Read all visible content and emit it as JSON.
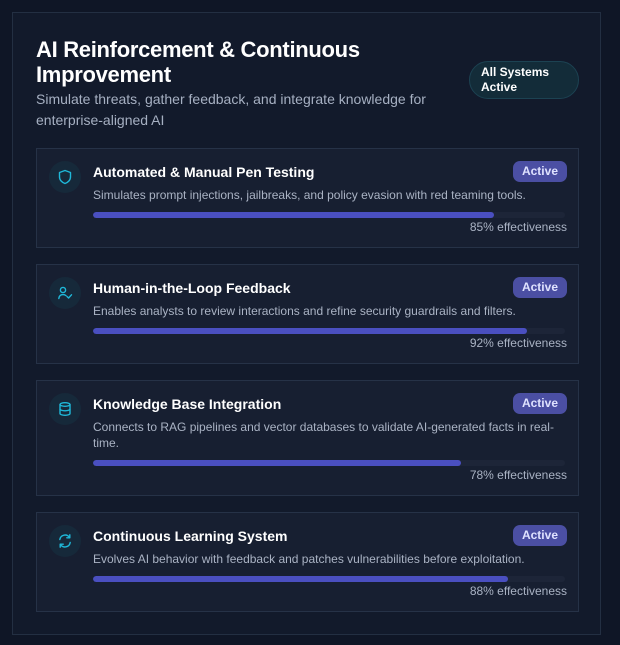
{
  "header": {
    "title": "AI Reinforcement & Continuous Improvement",
    "subtitle": "Simulate threats, gather feedback, and integrate knowledge for enterprise-aligned AI",
    "status_label": "All Systems Active"
  },
  "colors": {
    "accent": "#4a4fc0",
    "badge_bg": "#4b4fa3",
    "icon_color": "#1fb8d9"
  },
  "cards": [
    {
      "icon": "shield-icon",
      "title": "Automated & Manual Pen Testing",
      "badge": "Active",
      "description": "Simulates prompt injections, jailbreaks, and policy evasion with red teaming tools.",
      "effectiveness": 0.85,
      "effectiveness_label": "85% effectiveness"
    },
    {
      "icon": "user-check-icon",
      "title": "Human-in-the-Loop Feedback",
      "badge": "Active",
      "description": "Enables analysts to review interactions and refine security guardrails and filters.",
      "effectiveness": 0.92,
      "effectiveness_label": "92% effectiveness"
    },
    {
      "icon": "database-icon",
      "title": "Knowledge Base Integration",
      "badge": "Active",
      "description": "Connects to RAG pipelines and vector databases to validate AI-generated facts in real-time.",
      "effectiveness": 0.78,
      "effectiveness_label": "78% effectiveness"
    },
    {
      "icon": "refresh-icon",
      "title": "Continuous Learning System",
      "badge": "Active",
      "description": "Evolves AI behavior with feedback and patches vulnerabilities before exploitation.",
      "effectiveness": 0.88,
      "effectiveness_label": "88% effectiveness"
    }
  ]
}
